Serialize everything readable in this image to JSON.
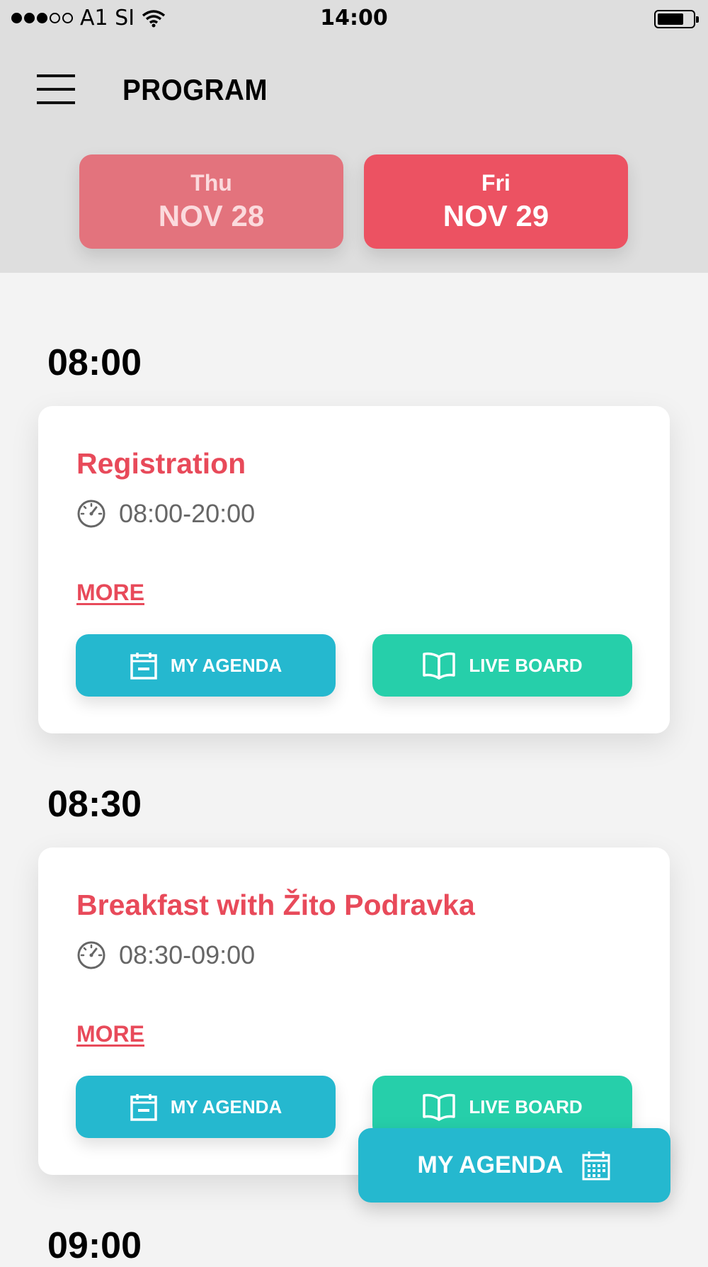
{
  "status_bar": {
    "carrier": "A1 SI",
    "time": "14:00"
  },
  "header": {
    "title": "PROGRAM"
  },
  "days": [
    {
      "dow": "Thu",
      "date": "NOV 28",
      "selected": false
    },
    {
      "dow": "Fri",
      "date": "NOV 29",
      "selected": true
    }
  ],
  "slots": [
    {
      "time": "08:00",
      "session": {
        "title": "Registration",
        "time_range": "08:00-20:00",
        "more_label": "MORE",
        "agenda_label": "MY AGENDA",
        "live_label": "LIVE BOARD"
      }
    },
    {
      "time": "08:30",
      "session": {
        "title": "Breakfast with Žito Podravka",
        "time_range": "08:30-09:00",
        "more_label": "MORE",
        "agenda_label": "MY AGENDA",
        "live_label": "LIVE BOARD"
      }
    },
    {
      "time": "09:00"
    }
  ],
  "fab": {
    "label": "MY AGENDA"
  },
  "colors": {
    "accent_red": "#e84a5a",
    "agenda_blue": "#25b8cf",
    "live_green": "#26cfaa",
    "header_gray": "#dedede"
  },
  "icons": [
    "menu-icon",
    "clock-icon",
    "calendar-minus-icon",
    "book-icon",
    "calendar-grid-icon",
    "wifi-icon",
    "battery-icon"
  ]
}
